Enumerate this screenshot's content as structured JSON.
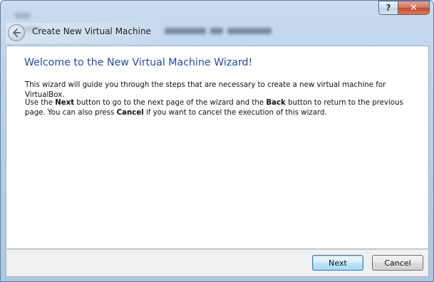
{
  "window": {
    "help_button": "?",
    "close_button": "✕"
  },
  "nav": {
    "title": "Create New Virtual Machine"
  },
  "content": {
    "heading": "Welcome to the New Virtual Machine Wizard!",
    "para1": "This wizard will guide you through the steps that are necessary to create a new virtual machine for VirtualBox.",
    "para2": {
      "t1": "Use the ",
      "b1": "Next",
      "t2": " button to go to the next page of the wizard and the ",
      "b2": "Back",
      "t3": " button to return to the previous page. You can also press ",
      "b3": "Cancel",
      "t4": " if you want to cancel the execution of this wizard."
    }
  },
  "footer": {
    "next_label": "Next",
    "cancel_label": "Cancel"
  },
  "colors": {
    "heading": "#1d4e9a",
    "accent_button": "#3c7fb1",
    "close_button": "#c34a2f"
  },
  "icons": {
    "back": "back-arrow-icon"
  }
}
